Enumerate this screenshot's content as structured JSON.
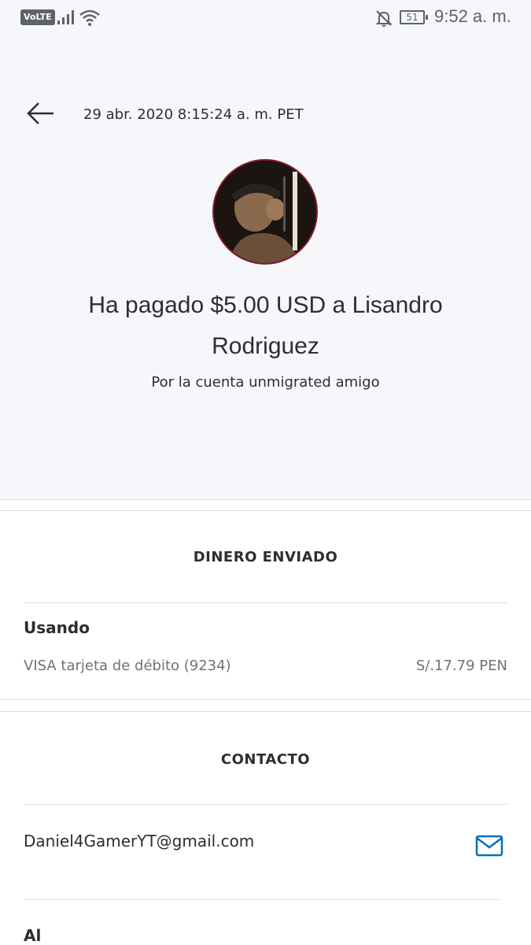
{
  "status_bar": {
    "network_label": "VoLTE",
    "battery_level": "51",
    "time": "9:52 a. m.",
    "icons": [
      "signal-icon",
      "wifi-icon",
      "notifications-off-icon",
      "battery-icon"
    ]
  },
  "header": {
    "back_icon": "arrow-left-icon",
    "datetime": "29 abr. 2020 8:15:24 a. m. PET"
  },
  "summary": {
    "headline": "Ha pagado $5.00 USD a Lisandro Rodriguez",
    "subline": "Por la cuenta unmigrated amigo"
  },
  "money_sent": {
    "title": "DINERO ENVIADO",
    "using_label": "Usando",
    "method": "VISA tarjeta de débito (9234)",
    "amount": "S/.17.79 PEN"
  },
  "contact": {
    "title": "CONTACTO",
    "email": "Daniel4GamerYT@gmail.com",
    "email_icon": "mail-icon",
    "to_label": "Al"
  },
  "colors": {
    "hero_background": "#f5f7fa",
    "text": "#2c2e2f",
    "muted_text": "#6c7378",
    "accent": "#0070ba"
  }
}
